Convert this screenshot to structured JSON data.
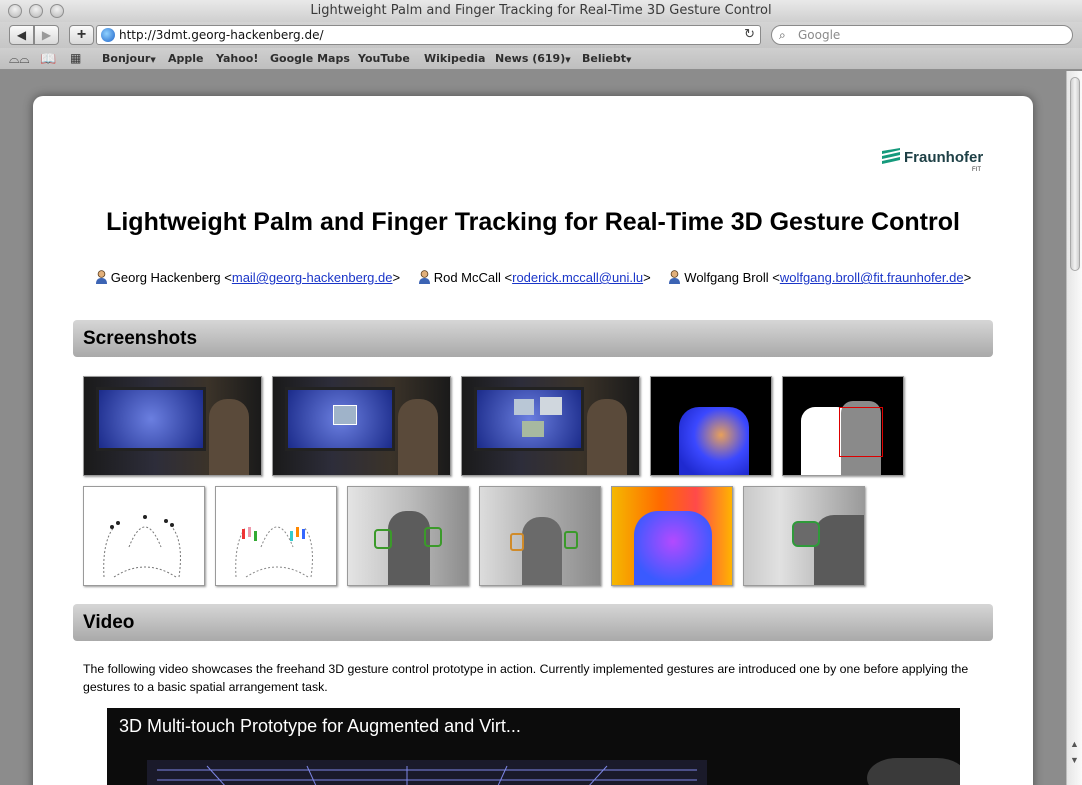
{
  "window": {
    "title": "Lightweight Palm and Finger Tracking for Real-Time 3D Gesture Control"
  },
  "toolbar": {
    "back_icon": "back-arrow-icon",
    "forward_icon": "forward-arrow-icon",
    "add_label": "+",
    "url": "http://3dmt.georg-hackenberg.de/",
    "search_placeholder": "Google"
  },
  "bookmarks": {
    "items": [
      "Bonjour",
      "Apple",
      "Yahoo!",
      "Google Maps",
      "YouTube",
      "Wikipedia",
      "News (619)",
      "Beliebt"
    ]
  },
  "page": {
    "logo": {
      "name": "Fraunhofer",
      "sub": "FIT"
    },
    "title": "Lightweight Palm and Finger Tracking for Real-Time 3D Gesture Control",
    "authors": [
      {
        "name": "Georg Hackenberg",
        "email": "mail@georg-hackenberg.de"
      },
      {
        "name": "Rod McCall",
        "email": "roderick.mccall@uni.lu"
      },
      {
        "name": "Wolfgang Broll",
        "email": "wolfgang.broll@fit.fraunhofer.de"
      }
    ],
    "sections": {
      "screenshots": "Screenshots",
      "video": "Video"
    },
    "video": {
      "description": "The following video showcases the freehand 3D gesture control prototype in action. Currently implemented gestures are introduced one by one before applying the gestures to a basic spatial arrangement task.",
      "player_title": "3D Multi-touch Prototype for Augmented and Virt..."
    },
    "screenshots": [
      {
        "name": "screenshot-hands-grid"
      },
      {
        "name": "screenshot-photo-grab"
      },
      {
        "name": "screenshot-photo-arrangement"
      },
      {
        "name": "screenshot-blue-depth"
      },
      {
        "name": "screenshot-segmentation"
      },
      {
        "name": "screenshot-points-black"
      },
      {
        "name": "screenshot-points-colored"
      },
      {
        "name": "screenshot-gray-tracking-1"
      },
      {
        "name": "screenshot-gray-tracking-2"
      },
      {
        "name": "screenshot-heatmap"
      },
      {
        "name": "screenshot-side-view"
      }
    ]
  }
}
